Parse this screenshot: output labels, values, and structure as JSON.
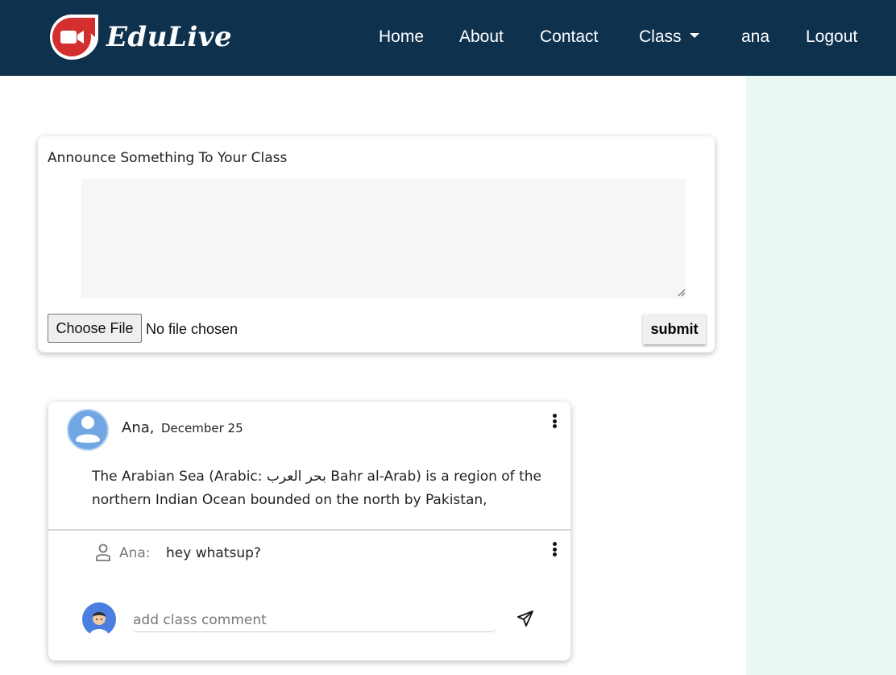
{
  "navbar": {
    "brand": "EduLive",
    "background": "#0e324e",
    "logo_color": "#d32f2f",
    "links": {
      "home": "Home",
      "about": "About",
      "contact": "Contact",
      "class": "Class",
      "user": "ana",
      "logout": "Logout"
    }
  },
  "sidebar": {
    "background": "#eaf7f3"
  },
  "announce": {
    "title": "Announce Something To Your Class",
    "textarea_value": "",
    "file_button": "Choose File",
    "file_status": "No file chosen",
    "submit": "submit"
  },
  "post": {
    "author": "Ana,",
    "date": "December 25",
    "body": "The Arabian Sea (Arabic: بحر العرب Bahr al-Arab) is a region of the northern Indian Ocean bounded on the north by Pakistan,",
    "avatar_icon": "user-avatar-icon",
    "menu_icon": "more-vertical-icon",
    "comment": {
      "author": "Ana:",
      "text": "hey whatsup?",
      "icon": "user-outline-icon"
    },
    "comment_input_placeholder": "add class comment",
    "send_icon": "send-icon"
  }
}
